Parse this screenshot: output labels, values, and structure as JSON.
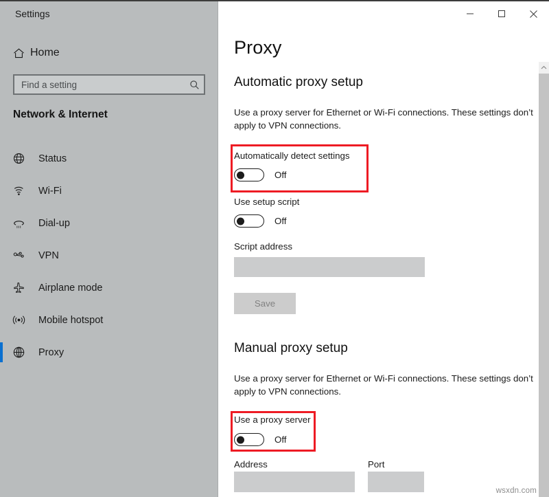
{
  "window": {
    "app_title": "Settings",
    "controls": [
      {
        "name": "minimize",
        "glyph": "─"
      },
      {
        "name": "maximize",
        "glyph": "□"
      },
      {
        "name": "close",
        "glyph": "✕"
      }
    ]
  },
  "sidebar": {
    "home_label": "Home",
    "home_icon": "home-icon",
    "search": {
      "placeholder": "Find a setting",
      "value": "",
      "icon": "search-icon"
    },
    "category_title": "Network & Internet",
    "items": [
      {
        "label": "Status",
        "icon": "status-globe-icon",
        "selected": false
      },
      {
        "label": "Wi-Fi",
        "icon": "wifi-icon",
        "selected": false
      },
      {
        "label": "Dial-up",
        "icon": "dialup-phone-icon",
        "selected": false
      },
      {
        "label": "VPN",
        "icon": "vpn-icon",
        "selected": false
      },
      {
        "label": "Airplane mode",
        "icon": "airplane-icon",
        "selected": false
      },
      {
        "label": "Mobile hotspot",
        "icon": "hotspot-icon",
        "selected": false
      },
      {
        "label": "Proxy",
        "icon": "proxy-globe-icon",
        "selected": true
      }
    ]
  },
  "main": {
    "page_title": "Proxy",
    "automatic_section": {
      "heading": "Automatic proxy setup",
      "description": "Use a proxy server for Ethernet or Wi-Fi connections. These settings don’t apply to VPN connections.",
      "auto_detect": {
        "label": "Automatically detect settings",
        "state": "Off",
        "highlighted": true
      },
      "setup_script": {
        "label": "Use setup script",
        "state": "Off",
        "highlighted": false
      },
      "script_address": {
        "label": "Script address",
        "value": "",
        "placeholder": ""
      },
      "save_label": "Save",
      "save_disabled": true
    },
    "manual_section": {
      "heading": "Manual proxy setup",
      "description": "Use a proxy server for Ethernet or Wi-Fi connections. These settings don’t apply to VPN connections.",
      "use_proxy": {
        "label": "Use a proxy server",
        "state": "Off",
        "highlighted": true
      },
      "address": {
        "label": "Address",
        "value": "",
        "placeholder": ""
      },
      "port": {
        "label": "Port",
        "value": "",
        "placeholder": ""
      }
    }
  },
  "scrollbar": {
    "up_arrow_icon": "chevron-up-icon"
  },
  "watermark": "wsxdn.com",
  "colors": {
    "sidebar_bg": "#b9bcbd",
    "accent": "#0a70d0",
    "annotation_red": "#ee1b24",
    "field_gray": "#cbcccd"
  }
}
